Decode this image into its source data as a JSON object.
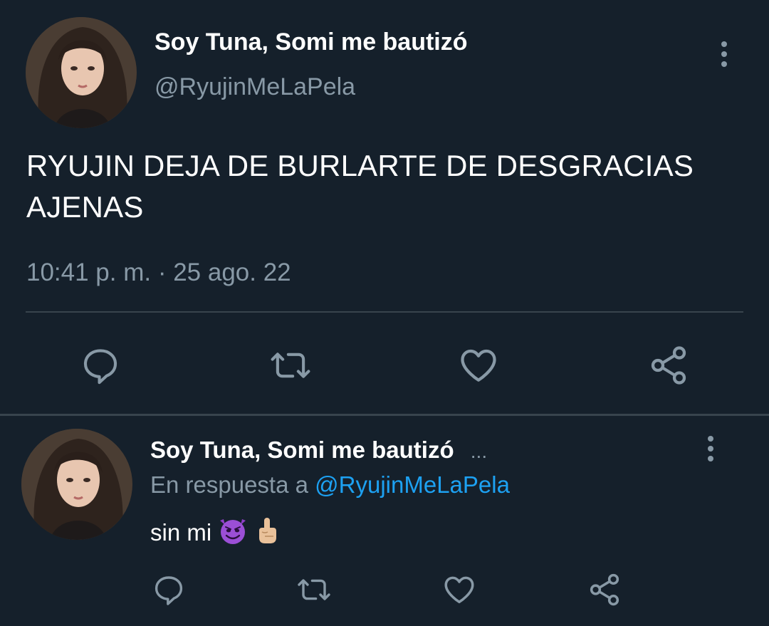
{
  "main_tweet": {
    "display_name": "Soy Tuna, Somi me bautizó",
    "handle": "@RyujinMeLaPela",
    "text_line1": "RYUJIN DEJA DE BURLARTE DE DESGRACIAS",
    "text_line2": "AJENAS",
    "timestamp": "10:41 p. m. · 25 ago. 22"
  },
  "reply_tweet": {
    "display_name": "Soy Tuna, Somi me bautizó",
    "overflow": "...",
    "reply_prefix": "En respuesta a",
    "reply_mention": "@RyujinMeLaPela",
    "text": "sin mi"
  },
  "icons": {
    "reply": "comment-icon",
    "retweet": "retweet-icon",
    "like": "heart-icon",
    "share": "share-icon",
    "more": "more-vertical-icon",
    "emoji1": "smiling-devil-emoji",
    "emoji2": "index-pointing-up-emoji"
  },
  "colors": {
    "background": "#15202b",
    "secondary_text": "#8899a6",
    "link": "#1da1f2",
    "divider": "#38444d"
  }
}
